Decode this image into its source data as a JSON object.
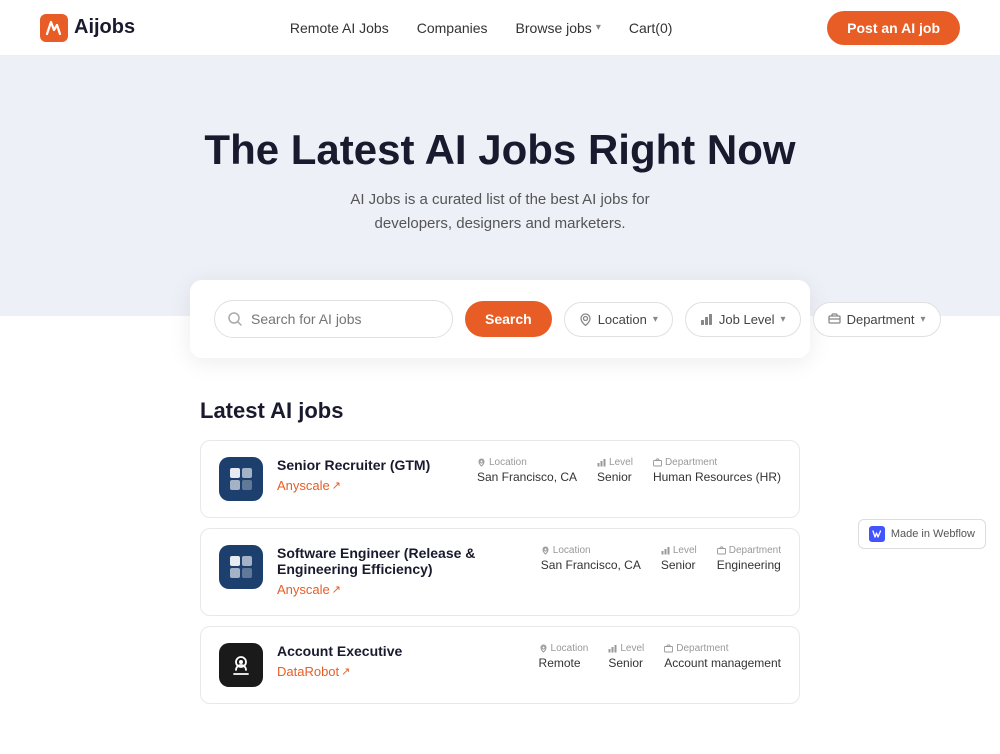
{
  "nav": {
    "logo_text": "Aijobs",
    "links": [
      {
        "label": "Remote AI Jobs",
        "id": "remote-ai-jobs"
      },
      {
        "label": "Companies",
        "id": "companies"
      },
      {
        "label": "Browse jobs",
        "id": "browse-jobs"
      },
      {
        "label": "Cart(0)",
        "id": "cart"
      }
    ],
    "post_job_label": "Post an AI job"
  },
  "hero": {
    "title": "The Latest AI Jobs Right Now",
    "subtitle": "AI Jobs is a curated list of the best AI jobs for developers, designers and marketers."
  },
  "search": {
    "placeholder": "Search for AI jobs",
    "search_button": "Search",
    "location_label": "Location",
    "job_level_label": "Job Level",
    "department_label": "Department"
  },
  "jobs_section": {
    "title": "Latest AI jobs",
    "jobs": [
      {
        "id": 1,
        "title": "Senior Recruiter (GTM)",
        "company": "Anyscale",
        "company_logo_type": "dark-blue",
        "location": "San Francisco, CA",
        "level": "Senior",
        "department": "Human Resources (HR)"
      },
      {
        "id": 2,
        "title": "Software Engineer (Release & Engineering Efficiency)",
        "company": "Anyscale",
        "company_logo_type": "dark-blue",
        "location": "San Francisco, CA",
        "level": "Senior",
        "department": "Engineering"
      },
      {
        "id": 3,
        "title": "Account Executive",
        "company": "DataRobot",
        "company_logo_type": "black",
        "location": "Remote",
        "level": "Senior",
        "department": "Account management"
      }
    ]
  },
  "meta_labels": {
    "location": "Location",
    "level": "Level",
    "department": "Department"
  },
  "webflow": {
    "label": "Made in Webflow"
  }
}
